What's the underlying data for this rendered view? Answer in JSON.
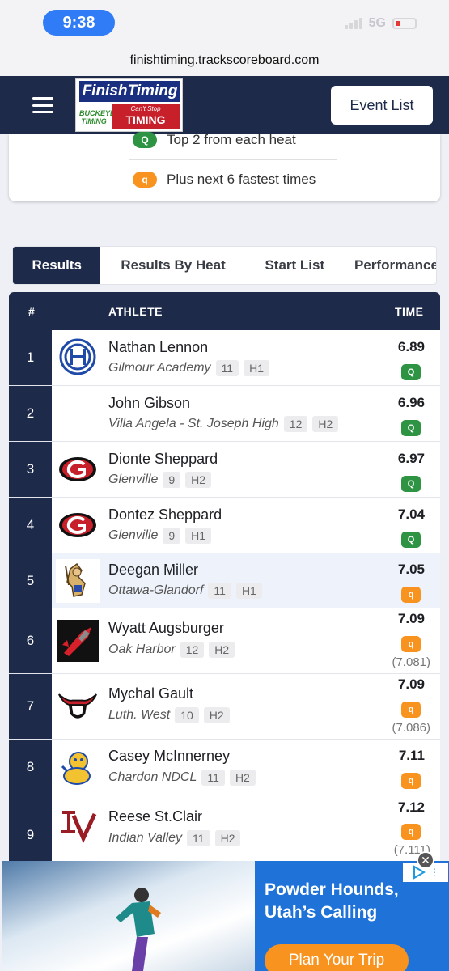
{
  "status": {
    "time": "9:38",
    "network": "5G"
  },
  "browser": {
    "url": "finishtiming.trackscoreboard.com"
  },
  "header": {
    "logo_text_top": "FinishTiming",
    "logo_text_left": "BUCKEYE TIMING",
    "logo_text_right_small": "Can't Stop",
    "logo_text_right_big": "TIMING",
    "event_button": "Event List"
  },
  "legend": [
    {
      "badge": "Q",
      "text": "Top 2 from each heat"
    },
    {
      "badge": "q",
      "text": "Plus next 6 fastest times"
    }
  ],
  "tabs": [
    "Results",
    "Results By Heat",
    "Start List",
    "Performance"
  ],
  "table": {
    "headers": {
      "place": "#",
      "athlete": "ATHLETE",
      "time": "TIME"
    },
    "rows": [
      {
        "place": "1",
        "name": "Nathan Lennon",
        "school": "Gilmour Academy",
        "grade": "11",
        "heat": "H1",
        "mark": "6.89",
        "qual": "Q",
        "exact": ""
      },
      {
        "place": "2",
        "name": "John Gibson",
        "school": "Villa Angela - St. Joseph High",
        "grade": "12",
        "heat": "H2",
        "mark": "6.96",
        "qual": "Q",
        "exact": ""
      },
      {
        "place": "3",
        "name": "Dionte Sheppard",
        "school": "Glenville",
        "grade": "9",
        "heat": "H2",
        "mark": "6.97",
        "qual": "Q",
        "exact": ""
      },
      {
        "place": "4",
        "name": "Dontez Sheppard",
        "school": "Glenville",
        "grade": "9",
        "heat": "H1",
        "mark": "7.04",
        "qual": "Q",
        "exact": ""
      },
      {
        "place": "5",
        "name": "Deegan Miller",
        "school": "Ottawa-Glandorf",
        "grade": "11",
        "heat": "H1",
        "mark": "7.05",
        "qual": "q",
        "exact": ""
      },
      {
        "place": "6",
        "name": "Wyatt Augsburger",
        "school": "Oak Harbor",
        "grade": "12",
        "heat": "H2",
        "mark": "7.09",
        "qual": "q",
        "exact": "(7.081)"
      },
      {
        "place": "7",
        "name": "Mychal Gault",
        "school": "Luth. West",
        "grade": "10",
        "heat": "H2",
        "mark": "7.09",
        "qual": "q",
        "exact": "(7.086)"
      },
      {
        "place": "8",
        "name": "Casey McInnerney",
        "school": "Chardon NDCL",
        "grade": "11",
        "heat": "H2",
        "mark": "7.11",
        "qual": "q",
        "exact": ""
      },
      {
        "place": "9",
        "name": "Reese St.Clair",
        "school": "Indian Valley",
        "grade": "11",
        "heat": "H2",
        "mark": "7.12",
        "qual": "q",
        "exact": "(7.111)"
      }
    ]
  },
  "ad": {
    "title": "Powder Hounds, Utah’s Calling",
    "cta": "Plan Your Trip"
  },
  "colors": {
    "navy": "#1e2a4a",
    "qualified_green": "#2e9444",
    "time_qualifier_orange": "#f7931e",
    "ad_blue": "#1e72d8"
  }
}
